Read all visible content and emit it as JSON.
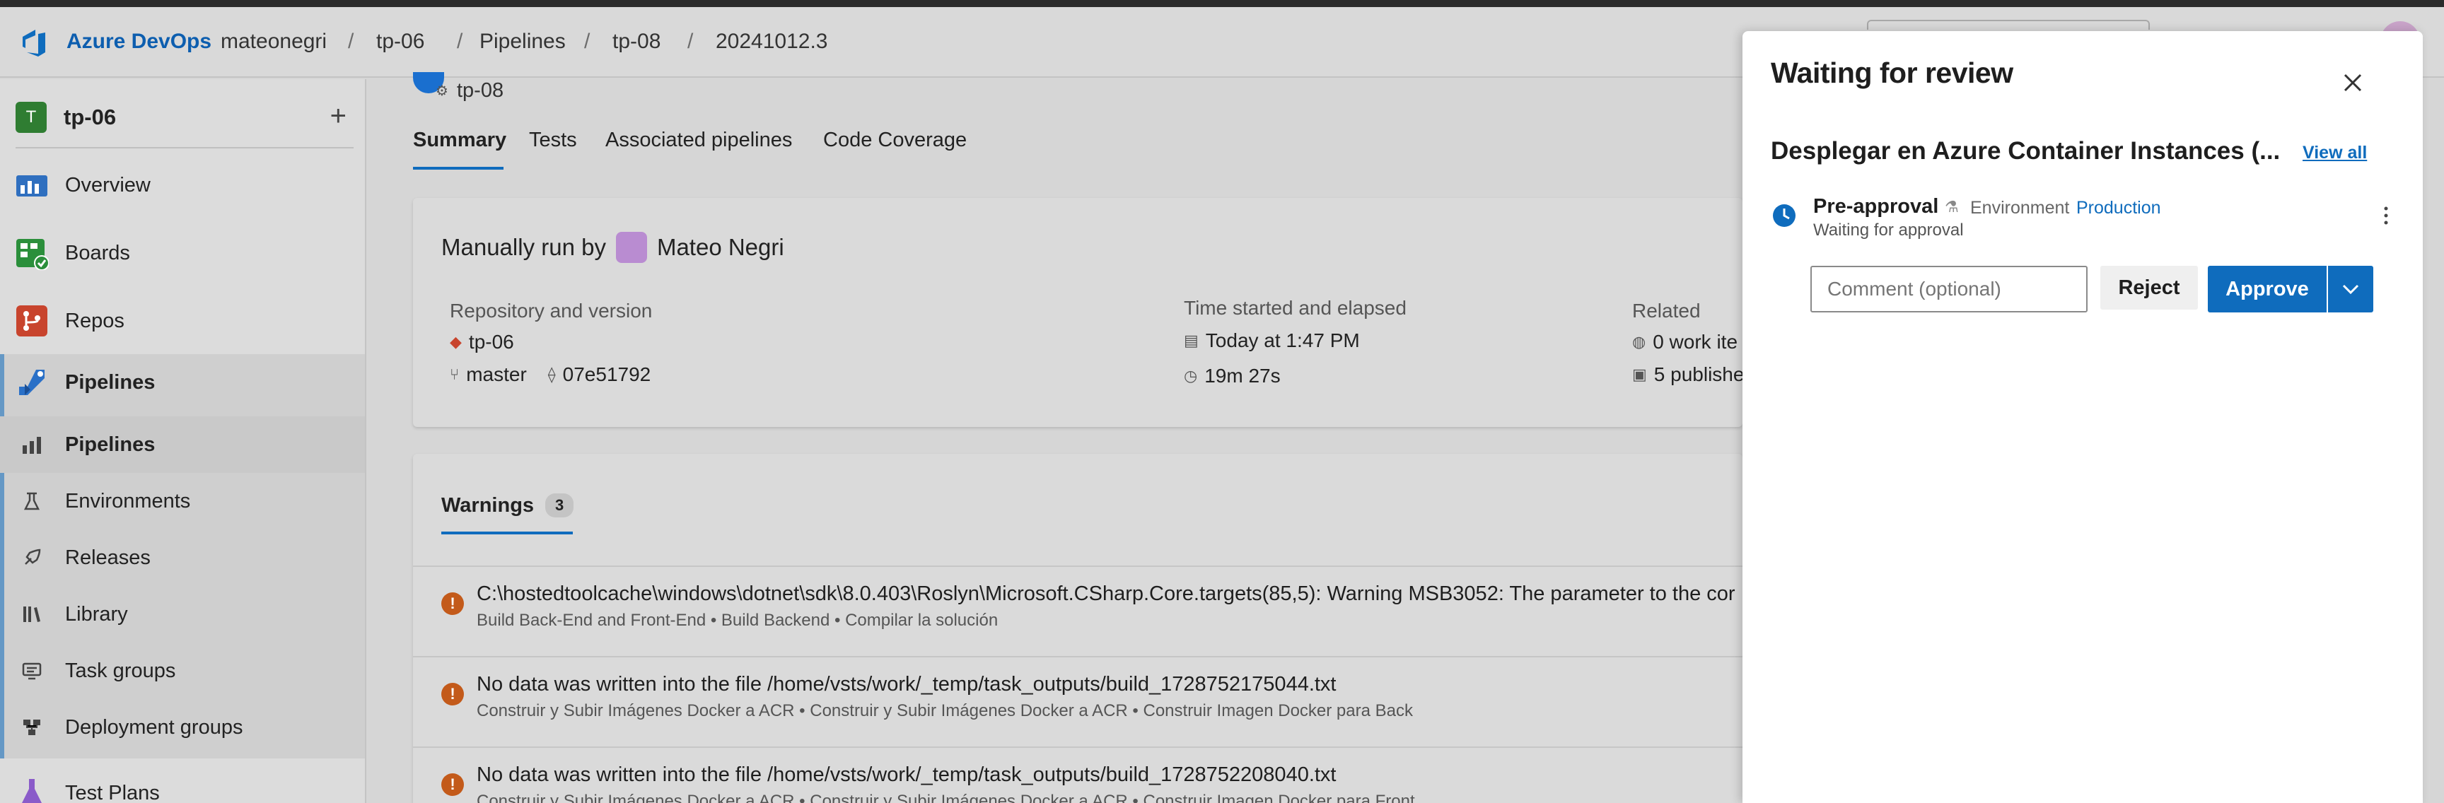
{
  "header": {
    "brand": "Azure DevOps",
    "breadcrumbs": [
      "mateonegri",
      "tp-06",
      "Pipelines",
      "tp-08",
      "20241012.3"
    ],
    "separator": "/"
  },
  "sidebar": {
    "project_initial": "T",
    "project_name": "tp-06",
    "add_icon": "+",
    "items": [
      {
        "label": "Overview",
        "icon": "overview-icon"
      },
      {
        "label": "Boards",
        "icon": "boards-icon"
      },
      {
        "label": "Repos",
        "icon": "repos-icon"
      },
      {
        "label": "Pipelines",
        "icon": "pipelines-icon"
      }
    ],
    "sub_items": [
      {
        "label": "Pipelines",
        "icon": "pipelines-sub-icon",
        "selected": true
      },
      {
        "label": "Environments",
        "icon": "environments-icon"
      },
      {
        "label": "Releases",
        "icon": "releases-icon"
      },
      {
        "label": "Library",
        "icon": "library-icon"
      },
      {
        "label": "Task groups",
        "icon": "task-groups-icon"
      },
      {
        "label": "Deployment groups",
        "icon": "deployment-groups-icon"
      }
    ],
    "test_plans": "Test Plans"
  },
  "main": {
    "pipeline_name": "tp-08",
    "tabs": [
      "Summary",
      "Tests",
      "Associated pipelines",
      "Code Coverage"
    ],
    "active_tab": "Summary",
    "summary": {
      "run_by_prefix": "Manually run by",
      "run_by_user": "Mateo Negri",
      "repo_title": "Repository and version",
      "repo_name": "tp-06",
      "branch": "master",
      "commit": "07e51792",
      "time_title": "Time started and elapsed",
      "started": "Today at 1:47 PM",
      "elapsed": "19m 27s",
      "related_title": "Related",
      "work_items": "0 work ite",
      "published": "5 publishe"
    },
    "warnings": {
      "label": "Warnings",
      "count": "3",
      "items": [
        {
          "message": "C:\\hostedtoolcache\\windows\\dotnet\\sdk\\8.0.403\\Roslyn\\Microsoft.CSharp.Core.targets(85,5): Warning MSB3052: The parameter to the cor",
          "path": "Build Back-End and Front-End • Build Backend • Compilar la solución"
        },
        {
          "message": "No data was written into the file /home/vsts/work/_temp/task_outputs/build_1728752175044.txt",
          "path": "Construir y Subir Imágenes Docker a ACR • Construir y Subir Imágenes Docker a ACR • Construir Imagen Docker para Back"
        },
        {
          "message": "No data was written into the file /home/vsts/work/_temp/task_outputs/build_1728752208040.txt",
          "path": "Construir y Subir Imágenes Docker a ACR • Construir y Subir Imágenes Docker a ACR • Construir Imagen Docker para Front"
        }
      ]
    }
  },
  "panel": {
    "title": "Waiting for review",
    "stage": "Desplegar en Azure Container Instances (...",
    "view_all": "View all",
    "check_name": "Pre-approval",
    "env_label": "Environment",
    "env_name": "Production",
    "status": "Waiting for approval",
    "comment_placeholder": "Comment (optional)",
    "reject_label": "Reject",
    "approve_label": "Approve"
  },
  "colors": {
    "accent": "#0f6cbd",
    "warning": "#c35a1a",
    "project_badge": "#2f7d32"
  }
}
